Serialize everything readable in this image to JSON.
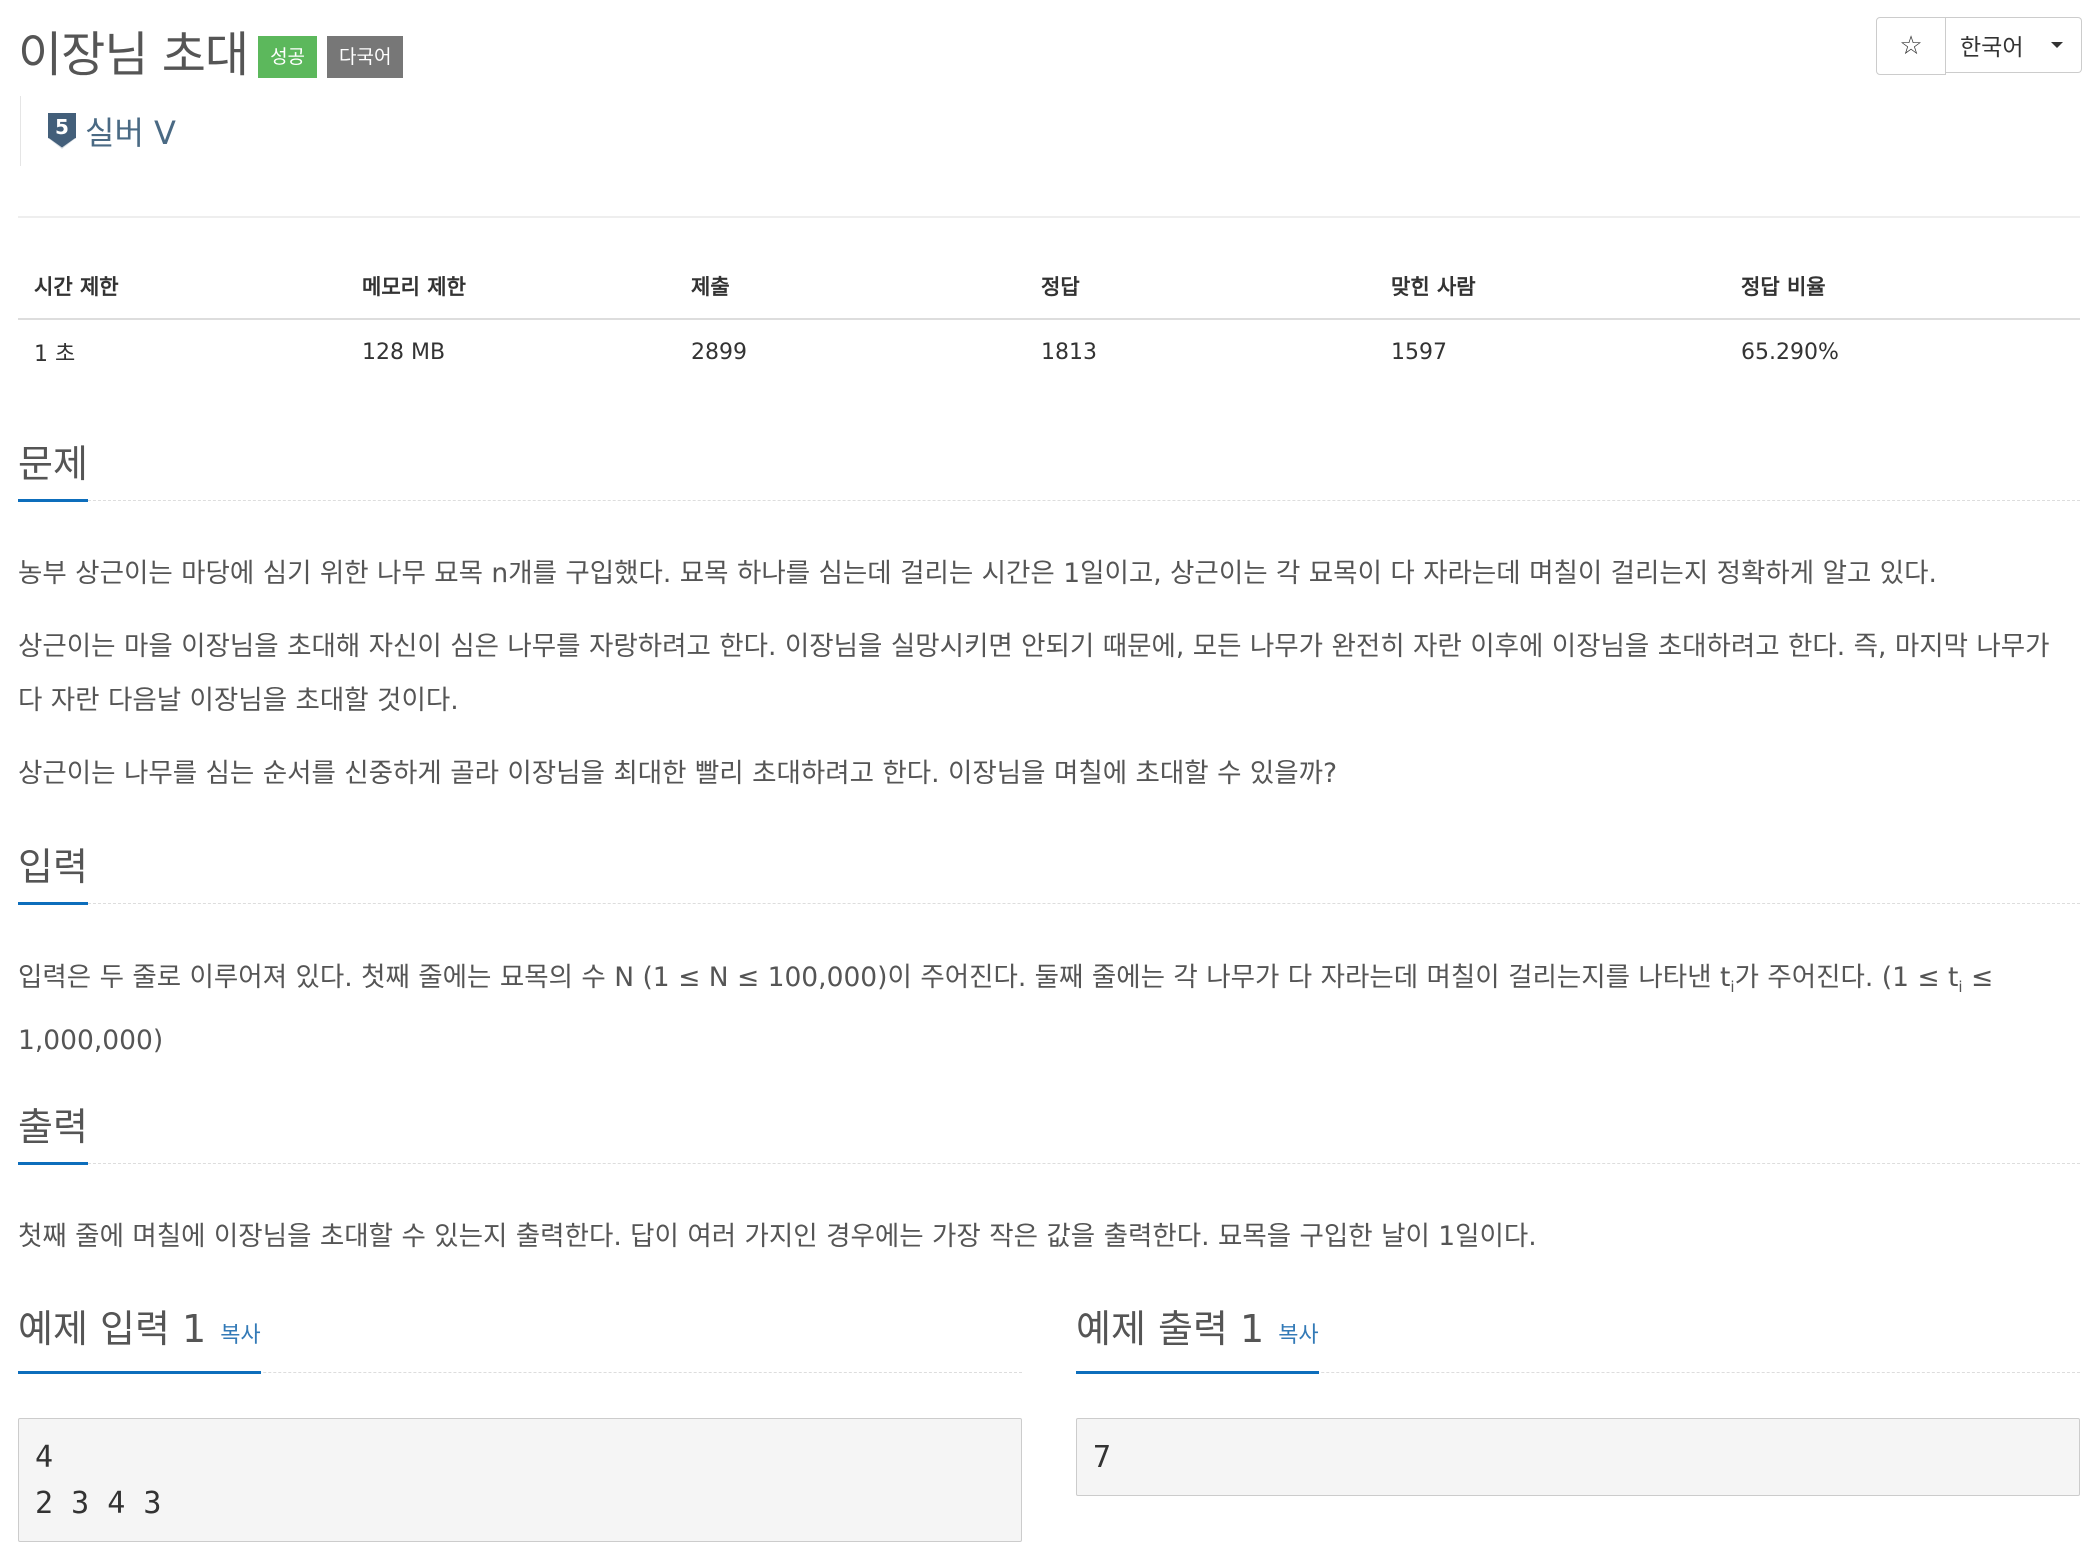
{
  "problem": {
    "title": "이장님 초대",
    "badges": [
      "성공",
      "다국어"
    ],
    "tier": {
      "number": "5",
      "label": "실버 V"
    }
  },
  "toolbar": {
    "star_icon": "☆",
    "language": "한국어"
  },
  "info_table": {
    "headers": [
      "시간 제한",
      "메모리 제한",
      "제출",
      "정답",
      "맞힌 사람",
      "정답 비율"
    ],
    "values": [
      "1 초",
      "128 MB",
      "2899",
      "1813",
      "1597",
      "65.290%"
    ]
  },
  "sections": {
    "problem": {
      "title": "문제",
      "paragraphs": [
        "농부 상근이는 마당에 심기 위한 나무 묘목 n개를 구입했다. 묘목 하나를 심는데 걸리는 시간은 1일이고, 상근이는 각 묘목이 다 자라는데 며칠이 걸리는지 정확하게 알고 있다.",
        "상근이는 마을 이장님을 초대해 자신이 심은 나무를 자랑하려고 한다. 이장님을 실망시키면 안되기 때문에, 모든 나무가 완전히 자란 이후에 이장님을 초대하려고 한다. 즉, 마지막 나무가 다 자란 다음날 이장님을 초대할 것이다.",
        "상근이는 나무를 심는 순서를 신중하게 골라 이장님을 최대한 빨리 초대하려고 한다. 이장님을 며칠에 초대할 수 있을까?"
      ]
    },
    "input": {
      "title": "입력",
      "text_a": "입력은 두 줄로 이루어져 있다. 첫째 줄에는 묘목의 수 N (1 ≤ N ≤ 100,000)이 주어진다. 둘째 줄에는 각 나무가 다 자라는데 며칠이 걸리는지를 나타낸 t",
      "sub_1": "i",
      "text_b": "가 주어진다. (1 ≤ t",
      "sub_2": "i",
      "text_c": " ≤ 1,000,000)"
    },
    "output": {
      "title": "출력",
      "text": "첫째 줄에 며칠에 이장님을 초대할 수 있는지 출력한다. 답이 여러 가지인 경우에는 가장 작은 값을 출력한다. 묘목을 구입한 날이 1일이다."
    }
  },
  "samples": {
    "input": {
      "title": "예제 입력 1",
      "copy_label": "복사",
      "content": "4\n2 3 4 3"
    },
    "output": {
      "title": "예제 출력 1",
      "copy_label": "복사",
      "content": "7"
    }
  },
  "colors": {
    "accent": "#0d6ebc",
    "success_badge": "#5cb85c",
    "multilang_badge": "#777777",
    "link": "#337ab7"
  }
}
